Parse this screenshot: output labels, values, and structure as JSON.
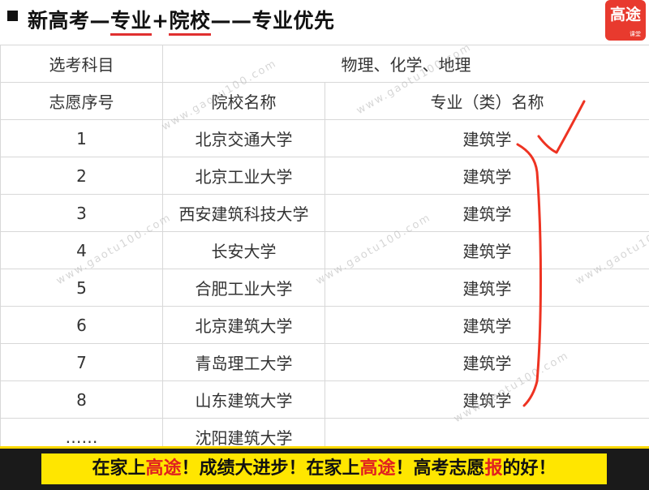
{
  "header": {
    "title_part1": "新高考—",
    "title_major": "专业",
    "title_plus": "+",
    "title_school": "院校",
    "title_part2": "——专业优先",
    "logo_text": "高途",
    "logo_sub": "课堂"
  },
  "table": {
    "subjects_label": "选考科目",
    "subjects_value": "物理、化学、地理",
    "headers": [
      "志愿序号",
      "院校名称",
      "专业（类）名称"
    ],
    "rows": [
      {
        "num": "1",
        "school": "北京交通大学",
        "major": "建筑学"
      },
      {
        "num": "2",
        "school": "北京工业大学",
        "major": "建筑学"
      },
      {
        "num": "3",
        "school": "西安建筑科技大学",
        "major": "建筑学"
      },
      {
        "num": "4",
        "school": "长安大学",
        "major": "建筑学"
      },
      {
        "num": "5",
        "school": "合肥工业大学",
        "major": "建筑学"
      },
      {
        "num": "6",
        "school": "北京建筑大学",
        "major": "建筑学"
      },
      {
        "num": "7",
        "school": "青岛理工大学",
        "major": "建筑学"
      },
      {
        "num": "8",
        "school": "山东建筑大学",
        "major": "建筑学"
      },
      {
        "num": "……",
        "school": "沈阳建筑大学",
        "major": ""
      }
    ]
  },
  "watermark": "www.gaotu100.com",
  "banner": {
    "p1": "在家上",
    "p2": "高途",
    "p3": "！成绩大进步！在家上",
    "p4": "高途",
    "p5": "！高考志愿",
    "p6": "报",
    "p7": "的好！"
  },
  "colors": {
    "accent": "#e83a2e",
    "banner_bg": "#ffe600",
    "annotation": "#ee3322"
  }
}
